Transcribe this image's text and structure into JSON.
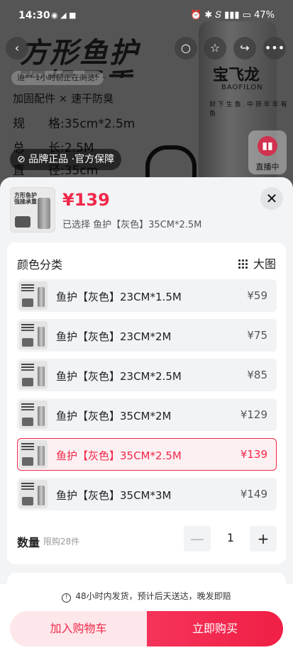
{
  "status_bar": {
    "time": "14:30",
    "apps": "◉ ◢ ■",
    "right": "⏰ ✱ 𝑆 ▮▮▮ ▭ 47%"
  },
  "background": {
    "title_line1": "方形鱼护",
    "title_line2": "强操承重",
    "viewers_text": "迪** 1小时前正在浏览!",
    "feature_line": "加固配件 × 速干防臭",
    "specs": [
      {
        "key": "规",
        "value": "格:35cm*2.5m"
      },
      {
        "key": "总",
        "value": "长:2.5M"
      },
      {
        "key": "直",
        "value": "径:35cm"
      }
    ],
    "can_logo": "宝飞龙",
    "can_sub": "BAOFILON",
    "can_small": "财 下 生 鱼 . 中 获 年 年 有 鱼",
    "brand_badge": "品牌正品 ·官方保障",
    "live_label": "直播中",
    "nav_icons": [
      "back-icon",
      "search-icon",
      "star-icon",
      "share-icon",
      "more-icon"
    ]
  },
  "sheet": {
    "price": "¥139",
    "selected_text": "已选择 鱼护【灰色】35CM*2.5M",
    "thumb_text": "方形鱼护\n强操承重",
    "close_icon": "close-icon",
    "section_title": "颜色分类",
    "big_view_label": "大图",
    "options": [
      {
        "label": "鱼护【灰色】23CM*1.5M",
        "price": "¥59",
        "selected": false
      },
      {
        "label": "鱼护【灰色】23CM*2M",
        "price": "¥75",
        "selected": false
      },
      {
        "label": "鱼护【灰色】23CM*2.5M",
        "price": "¥85",
        "selected": false
      },
      {
        "label": "鱼护【灰色】35CM*2M",
        "price": "¥129",
        "selected": false
      },
      {
        "label": "鱼护【灰色】35CM*2.5M",
        "price": "¥139",
        "selected": true
      },
      {
        "label": "鱼护【灰色】35CM*3M",
        "price": "¥149",
        "selected": false
      }
    ],
    "quantity_label": "数量",
    "quantity_limit": "限购28件",
    "quantity_value": "1",
    "minus_label": "—",
    "plus_label": "+"
  },
  "footer": {
    "notice": "48小时内发货，预计后天送达，晚发即赔",
    "add_to_cart": "加入购物车",
    "buy_now": "立即购买"
  },
  "colors": {
    "accent": "#f0284a",
    "sheet_bg": "#f3f4f6",
    "option_bg": "#f2f3f5"
  }
}
